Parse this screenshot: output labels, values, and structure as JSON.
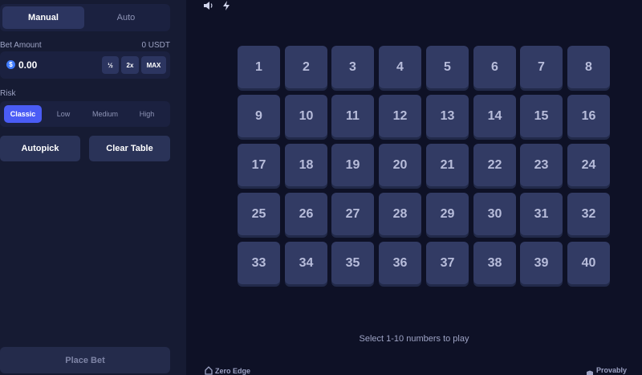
{
  "mode_tabs": {
    "manual": "Manual",
    "auto": "Auto",
    "active": "Manual"
  },
  "bet": {
    "label": "Bet Amount",
    "balance": "0 USDT",
    "currency_icon": "$",
    "value": "0.00",
    "half": "½",
    "double": "2x",
    "max": "MAX"
  },
  "risk": {
    "label": "Risk",
    "options": [
      "Classic",
      "Low",
      "Medium",
      "High"
    ],
    "selected": "Classic"
  },
  "actions": {
    "autopick": "Autopick",
    "clear_table": "Clear Table"
  },
  "place_bet": "Place Bet",
  "icons": {
    "sound": "speaker-icon",
    "turbo": "lightning-icon"
  },
  "numbers": [
    "1",
    "2",
    "3",
    "4",
    "5",
    "6",
    "7",
    "8",
    "9",
    "10",
    "11",
    "12",
    "13",
    "14",
    "15",
    "16",
    "17",
    "18",
    "19",
    "20",
    "21",
    "22",
    "23",
    "24",
    "25",
    "26",
    "27",
    "28",
    "29",
    "30",
    "31",
    "32",
    "33",
    "34",
    "35",
    "36",
    "37",
    "38",
    "39",
    "40"
  ],
  "hint": "Select 1-10 numbers to play",
  "footer": {
    "zero_edge": "Zero Edge",
    "provably_fair": "Provably Fair"
  },
  "colors": {
    "background": "#0e1126",
    "sidebar": "#161b33",
    "tile": "#323b64",
    "accent": "#4a5cf5"
  }
}
